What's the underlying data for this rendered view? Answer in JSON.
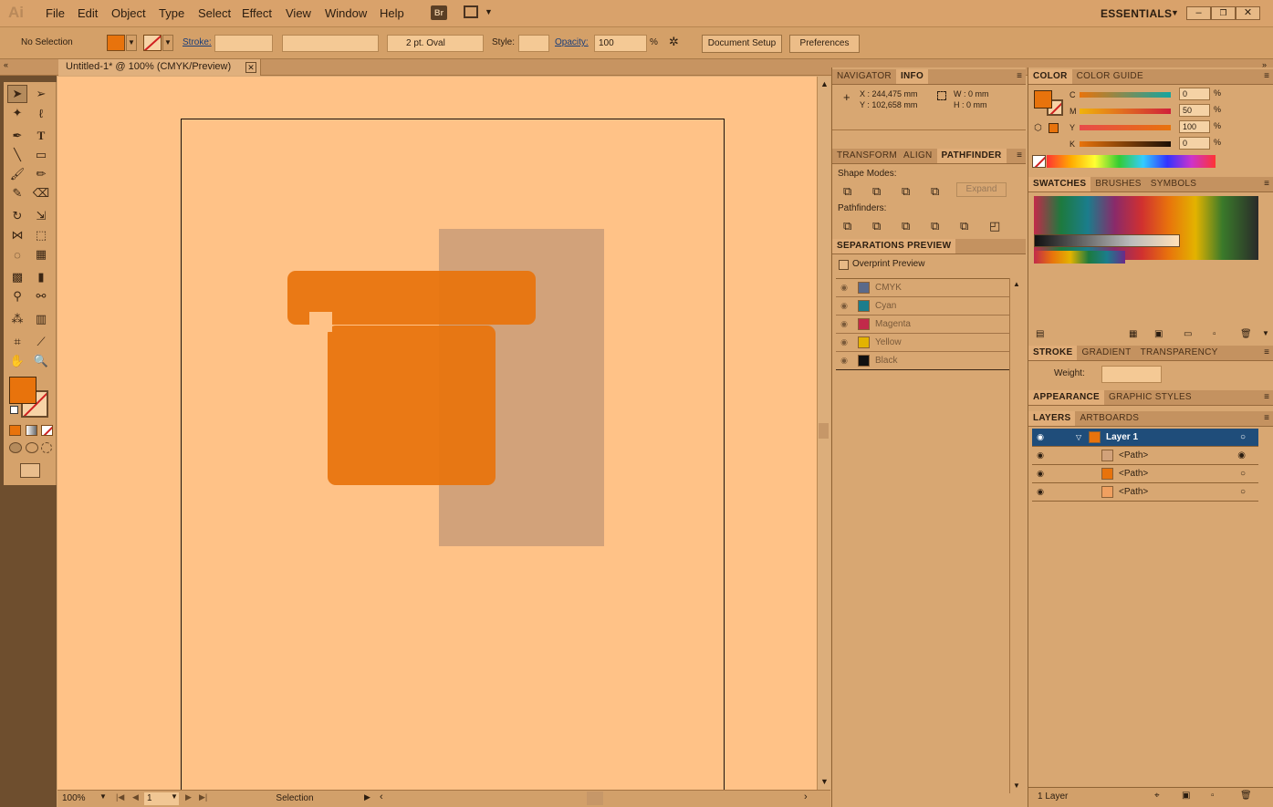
{
  "app": {
    "logo": "Ai",
    "workspace": "ESSENTIALS"
  },
  "menu": [
    "File",
    "Edit",
    "Object",
    "Type",
    "Select",
    "Effect",
    "View",
    "Window",
    "Help"
  ],
  "bridge_label": "Br",
  "control": {
    "selection": "No Selection",
    "stroke_label": "Stroke:",
    "brush": "2 pt. Oval",
    "style_label": "Style:",
    "opacity_label": "Opacity:",
    "opacity_value": "100",
    "opacity_unit": "%",
    "doc_setup": "Document Setup",
    "preferences": "Preferences"
  },
  "document": {
    "tab": "Untitled-1* @ 100% (CMYK/Preview)"
  },
  "status": {
    "zoom": "100%",
    "page": "1",
    "tool": "Selection"
  },
  "navigator": {
    "tabs": [
      "NAVIGATOR",
      "INFO"
    ],
    "x": "X : 244,475 mm",
    "y": "Y : 102,658 mm",
    "w": "W : 0 mm",
    "h": "H : 0 mm"
  },
  "pathfinder": {
    "tabs": [
      "TRANSFORM",
      "ALIGN",
      "PATHFINDER"
    ],
    "shape_modes": "Shape Modes:",
    "expand": "Expand",
    "pathfinders": "Pathfinders:"
  },
  "separations": {
    "title": "SEPARATIONS PREVIEW",
    "overprint": "Overprint Preview",
    "rows": [
      {
        "name": "CMYK",
        "color": "#5b6a8a"
      },
      {
        "name": "Cyan",
        "color": "#1b7d8c"
      },
      {
        "name": "Magenta",
        "color": "#c22a4a"
      },
      {
        "name": "Yellow",
        "color": "#e3b300"
      },
      {
        "name": "Black",
        "color": "#111111"
      }
    ]
  },
  "color": {
    "tabs": [
      "COLOR",
      "COLOR GUIDE"
    ],
    "channels": [
      {
        "label": "C",
        "value": "0",
        "pct": 0
      },
      {
        "label": "M",
        "value": "50",
        "pct": 50
      },
      {
        "label": "Y",
        "value": "100",
        "pct": 100
      },
      {
        "label": "K",
        "value": "0",
        "pct": 0
      }
    ],
    "unit": "%",
    "fill_color": "#e8730c"
  },
  "swatches": {
    "tabs": [
      "SWATCHES",
      "BRUSHES",
      "SYMBOLS"
    ]
  },
  "stroke": {
    "tabs": [
      "STROKE",
      "GRADIENT",
      "TRANSPARENCY"
    ],
    "weight_label": "Weight:"
  },
  "appearance": {
    "tabs": [
      "APPEARANCE",
      "GRAPHIC STYLES"
    ]
  },
  "layers": {
    "tabs": [
      "LAYERS",
      "ARTBOARDS"
    ],
    "layer_name": "Layer 1",
    "paths": [
      "<Path>",
      "<Path>",
      "<Path>"
    ],
    "count": "1 Layer"
  }
}
